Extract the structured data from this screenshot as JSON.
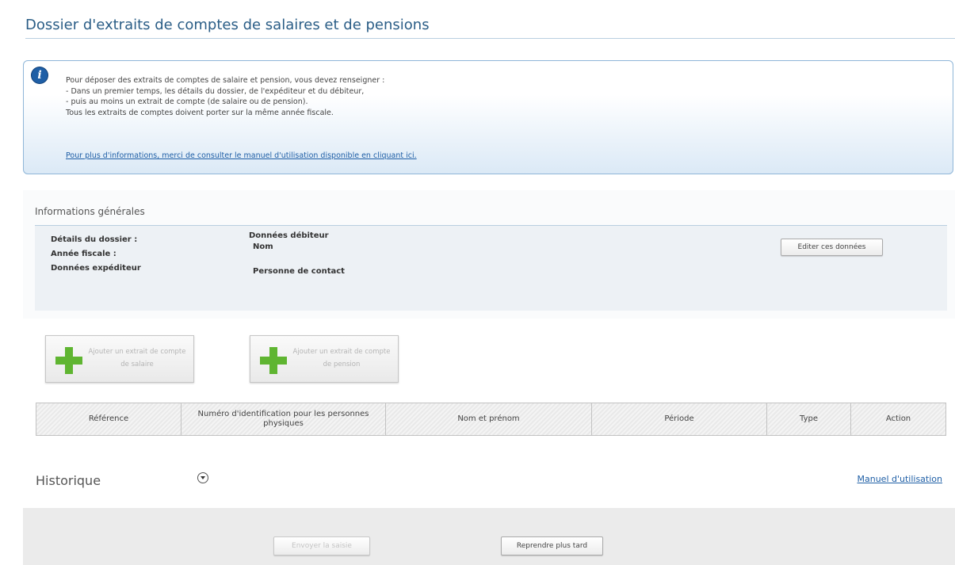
{
  "page": {
    "title": "Dossier d'extraits de comptes de salaires et de pensions"
  },
  "info": {
    "icon": "info-icon",
    "lines": [
      "Pour déposer des extraits de comptes de salaire et pension, vous devez renseigner :",
      "- Dans un premier temps, les détails du dossier, de l'expéditeur et du débiteur,",
      "- puis au moins un extrait de compte (de salaire ou de pension).",
      "Tous les extraits de comptes doivent porter sur la même année fiscale."
    ],
    "link": "Pour plus d'informations, merci de consulter le manuel d'utilisation disponible en cliquant ici."
  },
  "general": {
    "title": "Informations générales",
    "details_label": "Détails du dossier :",
    "year_label": "Année fiscale :",
    "sender_label": "Données expéditeur",
    "debtor_label": "Données débiteur",
    "name_label": "Nom",
    "contact_label": "Personne de contact",
    "edit_button": "Editer ces données"
  },
  "actions": {
    "add_salary": {
      "label": "Ajouter un extrait de compte de salaire",
      "icon": "plus-icon",
      "enabled": false
    },
    "add_pension": {
      "label": "Ajouter un extrait de compte de pension",
      "icon": "plus-icon",
      "enabled": false
    }
  },
  "table": {
    "columns": [
      "Référence",
      "Numéro d'identification pour les personnes physiques",
      "Nom et prénom",
      "Période",
      "Type",
      "Action"
    ],
    "rows": []
  },
  "history": {
    "title": "Historique",
    "toggle_icon": "chevron-down-circle-icon",
    "manual_link": "Manuel d'utilisation"
  },
  "footer": {
    "send_button": "Envoyer la saisie",
    "later_button": "Reprendre plus tard"
  },
  "colors": {
    "title_blue": "#2a5d86",
    "link_blue": "#1f5fa6",
    "plus_green": "#5fb531",
    "info_border": "#8fb6d8"
  }
}
